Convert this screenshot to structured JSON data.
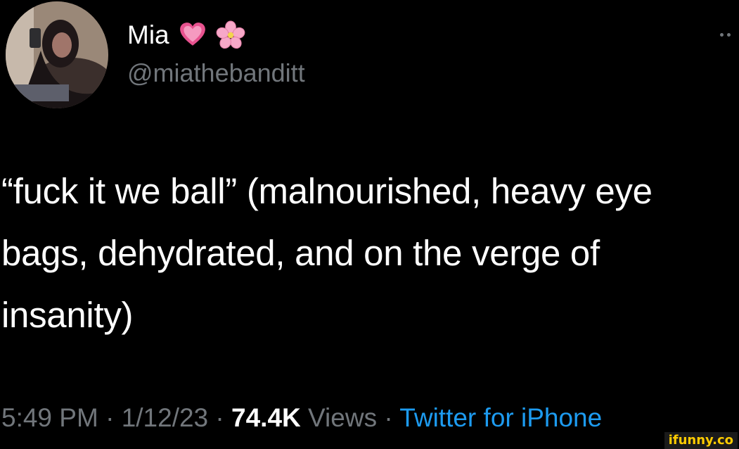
{
  "tweet": {
    "author": {
      "display_name": "Mia",
      "name_emojis": [
        "heart-icon",
        "cherry-blossom-icon"
      ],
      "handle": "@miathebanditt"
    },
    "text": "“fuck it we ball” (malnourished, heavy eye bags, dehydrated, and on the verge of insanity)",
    "meta": {
      "time": "5:49 PM",
      "separator": " · ",
      "date": "1/12/23",
      "views_count": "74.4K",
      "views_label": "Views",
      "source": "Twitter for iPhone"
    }
  },
  "watermark": "ifunny.co",
  "colors": {
    "background": "#000000",
    "primary_text": "#ffffff",
    "secondary_text": "#71767b",
    "link": "#1d9bf0"
  }
}
